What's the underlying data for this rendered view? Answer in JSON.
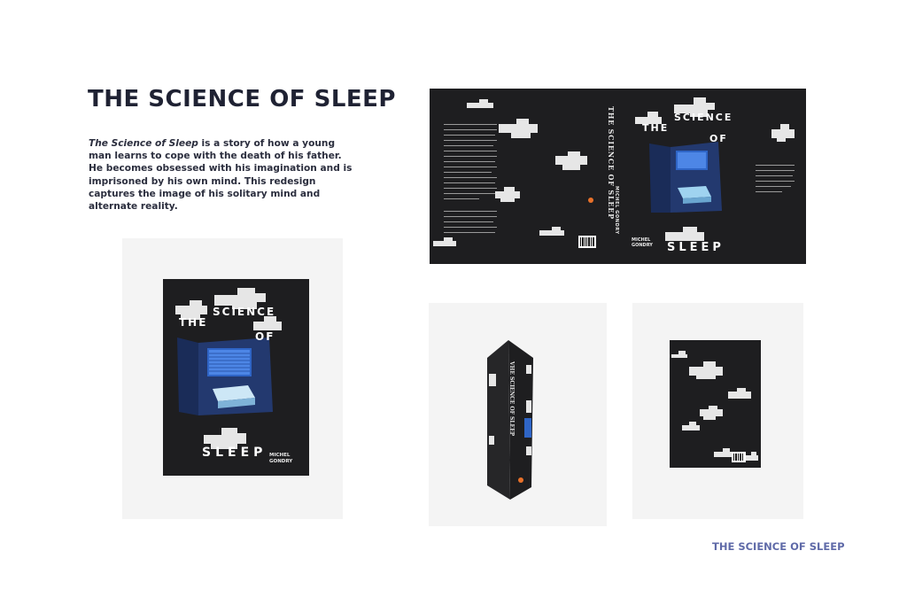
{
  "header": {
    "title": "THE SCIENCE OF SLEEP"
  },
  "description": {
    "italic": "The Science of Sleep",
    "rest": " is a story of how a young man learns to cope with the death of his father. He becomes obsessed with his imagination and is imprisoned by his own mind. This redesign captures the image of his solitary mind and alternate reality."
  },
  "spread": {
    "spine_title": "THE SCIENCE OF SLEEP",
    "spine_author": "MICHEL GONDRY",
    "author": "MICHEL GONDRY",
    "cover_words": [
      "THE",
      "SCIENCE",
      "OF",
      "SLEEP"
    ]
  },
  "front_cover": {
    "words": [
      "THE",
      "SCIENCE",
      "OF",
      "SLEEP"
    ],
    "author": "MICHEL GONDRY"
  },
  "footer": {
    "label": "THE SCIENCE OF SLEEP"
  },
  "colors": {
    "accent": "#5f6aa8",
    "cover": "#1e1e20",
    "room_blue": "#3d6fd6"
  }
}
